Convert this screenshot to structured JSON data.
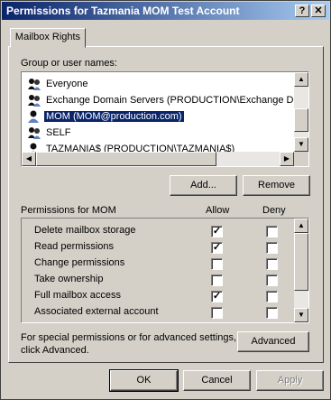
{
  "window": {
    "title": "Permissions for Tazmania MOM Test Account"
  },
  "titlebar": {
    "help_glyph": "?",
    "close_glyph": "✕"
  },
  "tabs": [
    {
      "label": "Mailbox Rights"
    }
  ],
  "users": {
    "label": "Group or user names:",
    "items": [
      {
        "name": "Everyone"
      },
      {
        "name": "Exchange Domain Servers (PRODUCTION\\Exchange Do..."
      },
      {
        "name": "MOM (MOM@production.com)",
        "selected": true
      },
      {
        "name": "SELF"
      },
      {
        "name": "TAZMANIA$ (PRODUCTION\\TAZMANIA$)"
      }
    ]
  },
  "buttons": {
    "add": "Add...",
    "remove": "Remove",
    "advanced": "Advanced",
    "ok": "OK",
    "cancel": "Cancel",
    "apply": "Apply"
  },
  "permissions": {
    "label": "Permissions for MOM",
    "allow_header": "Allow",
    "deny_header": "Deny",
    "rows": [
      {
        "name": "Delete mailbox storage",
        "allow": true,
        "deny": false
      },
      {
        "name": "Read permissions",
        "allow": true,
        "deny": false
      },
      {
        "name": "Change permissions",
        "allow": false,
        "deny": false
      },
      {
        "name": "Take ownership",
        "allow": false,
        "deny": false
      },
      {
        "name": "Full mailbox access",
        "allow": true,
        "deny": false
      },
      {
        "name": "Associated external account",
        "allow": false,
        "deny": false
      }
    ]
  },
  "advanced_text": {
    "line1": "For special permissions or for advanced settings,",
    "line2": "click Advanced."
  },
  "scroll_glyphs": {
    "up": "▲",
    "down": "▼",
    "left": "◀",
    "right": "▶"
  },
  "check_glyph": "✓"
}
